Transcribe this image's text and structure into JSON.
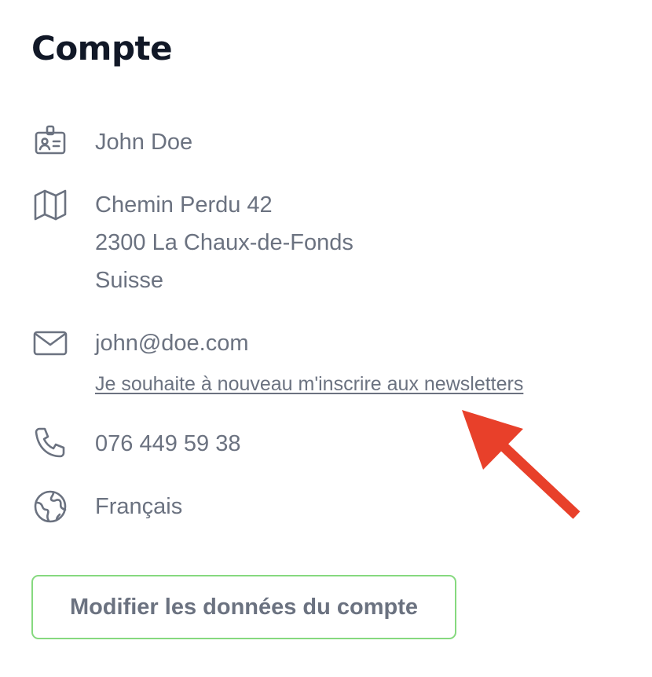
{
  "account": {
    "title": "Compte",
    "name": "John Doe",
    "address": {
      "line1": "Chemin Perdu 42",
      "line2": "2300 La Chaux-de-Fonds",
      "line3": "Suisse"
    },
    "email": "john@doe.com",
    "newsletter_link": "Je souhaite à nouveau m'inscrire aux newsletters",
    "phone": "076 449 59 38",
    "language": "Français",
    "edit_button": "Modifier les données du compte"
  },
  "icons": {
    "name": "id-badge-icon",
    "address": "map-icon",
    "email": "envelope-icon",
    "phone": "phone-icon",
    "language": "globe-icon"
  },
  "colors": {
    "title": "#111827",
    "text": "#6b7280",
    "button_border": "#86d97f",
    "annotation_arrow": "#e8402a"
  }
}
